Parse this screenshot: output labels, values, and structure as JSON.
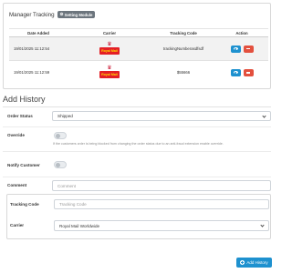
{
  "tracking_panel": {
    "title": "Manager Tracking",
    "badge": "Setting Module",
    "columns": [
      "Date Added",
      "Carrier",
      "Tracking Code",
      "Action"
    ],
    "rows": [
      {
        "date": "19/01/2025 11:12:54",
        "carrier_logo_text": "Royal Mail",
        "tracking_code": "trackingNumberasdfsdf"
      },
      {
        "date": "19/01/2025 11:12:59",
        "carrier_logo_text": "Royal Mail",
        "tracking_code": "$55666"
      }
    ]
  },
  "add_history": {
    "title": "Add History",
    "order_status": {
      "label": "Order Status",
      "value": "Shipped"
    },
    "override": {
      "label": "Override",
      "help": "If the customers order is being blocked from changing the order status due to an anti-fraud extension enable override."
    },
    "notify": {
      "label": "Notify Customer"
    },
    "comment": {
      "label": "Comment",
      "placeholder": "Comment"
    },
    "tracking_code": {
      "label": "Tracking Code",
      "placeholder": "Tracking Code"
    },
    "carrier": {
      "label": "Carrier",
      "value": "Royal Mail Worldwide"
    },
    "submit_label": "Add History"
  },
  "colors": {
    "primary": "#1e91cf",
    "danger": "#e3503e",
    "royal_mail_red": "#e41f26",
    "royal_mail_yellow": "#ffdd00"
  }
}
